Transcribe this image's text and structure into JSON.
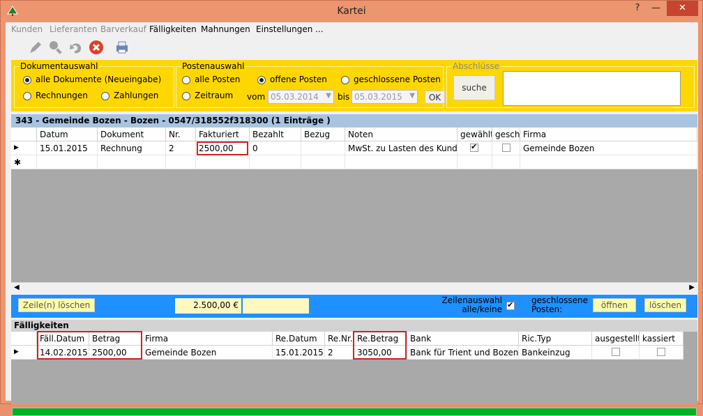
{
  "window": {
    "title": "Kartei",
    "min": "—",
    "max": "□",
    "close": "✕",
    "help": "?"
  },
  "menu": [
    "Kunden",
    "Lieferanten",
    "Barverkauf",
    "Fälligkeiten",
    "Mahnungen",
    "Einstellungen ..."
  ],
  "filters": {
    "dokumentauswahl": {
      "legend": "Dokumentauswahl",
      "opt_all": "alle Dokumente (Neueingabe)",
      "opt_rechnungen": "Rechnungen",
      "opt_zahlungen": "Zahlungen"
    },
    "postenauswahl": {
      "legend": "Postenauswahl",
      "opt_alle": "alle Posten",
      "opt_offene": "offene Posten",
      "opt_geschlossene": "geschlossene Posten",
      "opt_zeitraum": "Zeitraum",
      "vom": "vom",
      "bis": "bis",
      "date_from": "05.03.2014",
      "date_to": "05.03.2015",
      "ok": "OK"
    },
    "abschluesse": {
      "legend": "Abschlüsse",
      "search": "suche"
    }
  },
  "grid1": {
    "header": "343 - Gemeinde Bozen - Bozen - 0547/318552f318300 (1 Einträge )",
    "columns": [
      "Datum",
      "Dokument",
      "Nr.",
      "Fakturiert",
      "Bezahlt",
      "Bezug",
      "Noten",
      "gewählt",
      "geschl",
      "Firma"
    ],
    "rows": [
      {
        "datum": "15.01.2015",
        "dokument": "Rechnung",
        "nr": "2",
        "fakturiert": "2500,00",
        "bezahlt": "0",
        "bezug": "",
        "noten": "MwSt. zu Lasten des Kund",
        "gewaehlt": true,
        "geschl": false,
        "firma": "Gemeinde Bozen"
      }
    ],
    "new_row_marker": "✱",
    "row_marker": "▶"
  },
  "actions": {
    "delete_rows": "Zeile(n) löschen",
    "total": "2.500,00 €",
    "zeilenauswahl": "Zeilenauswahl alle/keine",
    "zeilenauswahl_checked": true,
    "geschlossene": "geschlossene Posten:",
    "open": "öffnen",
    "delete": "löschen"
  },
  "faelligkeiten": {
    "header": "Fälligkeiten",
    "columns": [
      "Fäll.Datum",
      "Betrag",
      "Firma",
      "Re.Datum",
      "Re.Nr.",
      "Re.Betrag",
      "Bank",
      "Ric.Typ",
      "ausgestellt",
      "kassiert"
    ],
    "rows": [
      {
        "faell_datum": "14.02.2015",
        "betrag": "2500,00",
        "firma": "Gemeinde Bozen",
        "re_datum": "15.01.2015",
        "re_nr": "2",
        "re_betrag": "3050,00",
        "bank": "Bank für Trient und Bozen",
        "ric_typ": "Bankeinzug",
        "ausgestellt": false,
        "kassiert": false
      }
    ]
  },
  "progress": 1.0,
  "colors": {
    "accent_gold": "#ffd700",
    "blue_bar": "#1e90ff",
    "progress_green": "#06b025",
    "highlight_red": "#d42020",
    "title_orange": "#ec956f"
  }
}
